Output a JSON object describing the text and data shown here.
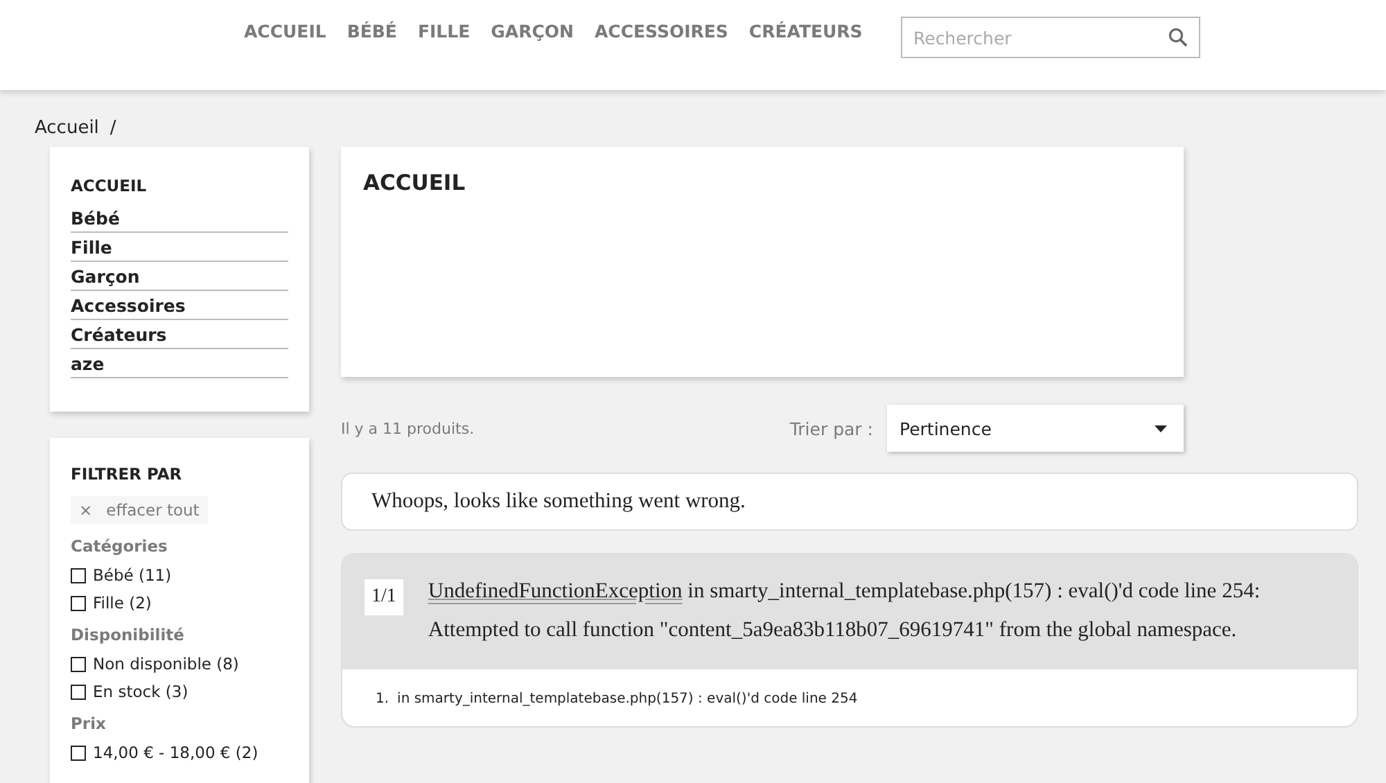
{
  "nav": [
    "ACCUEIL",
    "BÉBÉ",
    "FILLE",
    "GARÇON",
    "ACCESSOIRES",
    "CRÉATEURS"
  ],
  "search": {
    "placeholder": "Rechercher"
  },
  "breadcrumb": [
    "Accueil",
    "/"
  ],
  "category_menu": {
    "title": "ACCUEIL",
    "items": [
      "Bébé",
      "Fille",
      "Garçon",
      "Accessoires",
      "Créateurs",
      "aze"
    ]
  },
  "filters": {
    "title": "FILTRER PAR",
    "clear": {
      "icon": "×",
      "label": "effacer tout"
    },
    "groups": [
      {
        "title": "Catégories",
        "options": [
          {
            "label": "Bébé (11)",
            "checked": false
          },
          {
            "label": "Fille (2)",
            "checked": false
          }
        ]
      },
      {
        "title": "Disponibilité",
        "options": [
          {
            "label": "Non disponible (8)",
            "checked": false
          },
          {
            "label": "En stock (3)",
            "checked": false
          }
        ]
      },
      {
        "title": "Prix",
        "options": [
          {
            "label": "14,00 € - 18,00 € (2)",
            "checked": false
          }
        ]
      }
    ]
  },
  "category_title": "ACCUEIL",
  "product_count": "Il y a 11 produits.",
  "sort": {
    "label": "Trier par :",
    "value": "Pertinence"
  },
  "error": {
    "message": "Whoops, looks like something went wrong.",
    "counter": "1/1",
    "exception": "UndefinedFunctionException",
    "text": " in smarty_internal_templatebase.php(157) : eval()'d code line 254: Attempted to call function \"content_5a9ea83b118b07_69619741\" from the global namespace.",
    "trace": [
      {
        "number": "1.",
        "text": "in smarty_internal_templatebase.php(157) : eval()'d code line 254"
      }
    ]
  }
}
